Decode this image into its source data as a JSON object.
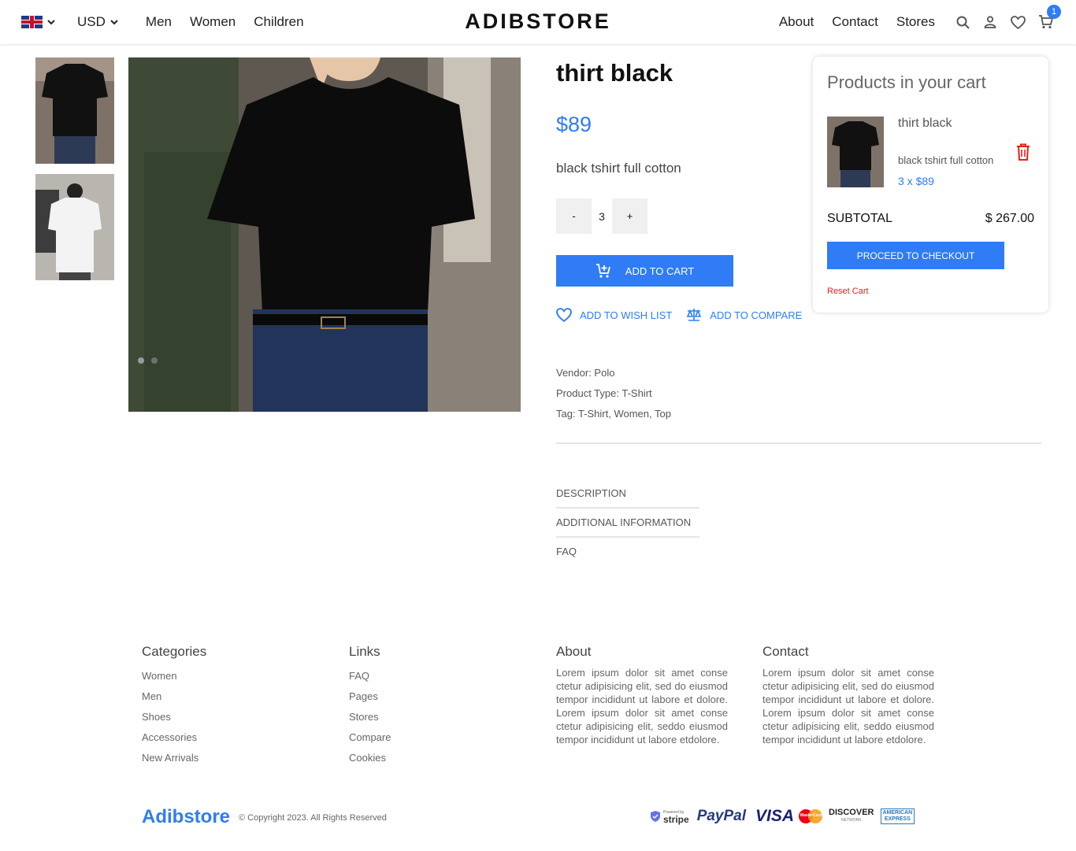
{
  "nav": {
    "currency": "USD",
    "links_left": [
      "Men",
      "Women",
      "Children"
    ],
    "brand": "ADIBSTORE",
    "links_right": [
      "About",
      "Contact",
      "Stores"
    ],
    "cart_count": "1"
  },
  "product": {
    "title": "thirt black",
    "price": "$89",
    "description": "black tshirt full cotton",
    "quantity": "3",
    "qty_minus": "-",
    "qty_plus": "+",
    "add_to_cart": "ADD TO CART",
    "add_to_wishlist": "ADD TO WISH LIST",
    "add_to_compare": "ADD TO COMPARE",
    "vendor": "Vendor: Polo",
    "product_type": "Product Type: T-Shirt",
    "tags": "Tag: T-Shirt, Women, Top",
    "tabs": [
      "DESCRIPTION",
      "ADDITIONAL INFORMATION",
      "FAQ"
    ]
  },
  "cart": {
    "heading": "Products in your cart",
    "item_title": "thirt black",
    "item_desc": "black tshirt full cotton",
    "item_qty_price": "3 x $89",
    "subtotal_label": "SUBTOTAL",
    "subtotal_value": "$ 267.00",
    "checkout": "PROCEED TO CHECKOUT",
    "reset": "Reset Cart"
  },
  "footer": {
    "categories": {
      "title": "Categories",
      "items": [
        "Women",
        "Men",
        "Shoes",
        "Accessories",
        "New Arrivals"
      ]
    },
    "links": {
      "title": "Links",
      "items": [
        "FAQ",
        "Pages",
        "Stores",
        "Compare",
        "Cookies"
      ]
    },
    "about": {
      "title": "About",
      "text": "Lorem ipsum dolor sit amet conse ctetur adipisicing elit, sed do eiusmod tempor incididunt ut labore et dolore. Lorem ipsum dolor sit amet conse ctetur adipisicing elit, seddo eiusmod tempor incididunt ut labore etdolore."
    },
    "contact": {
      "title": "Contact",
      "text": "Lorem ipsum dolor sit amet conse ctetur adipisicing elit, sed do eiusmod tempor incididunt ut labore et dolore. Lorem ipsum dolor sit amet conse ctetur adipisicing elit, seddo eiusmod tempor incididunt ut labore etdolore."
    },
    "brand": "Adibstore",
    "copyright": "© Copyright 2023. All Rights Reserved",
    "payments": {
      "stripe_small": "Powered by",
      "stripe": "stripe",
      "paypal": "PayPal",
      "visa": "VISA",
      "mastercard": "MasterCard",
      "discover": "DISCOVER",
      "discover_sub": "NETWORK",
      "amex_top": "AMERICAN",
      "amex_bottom": "EXPRESS"
    }
  },
  "colors": {
    "accent": "#2f7cf6",
    "danger": "#e0221d"
  }
}
